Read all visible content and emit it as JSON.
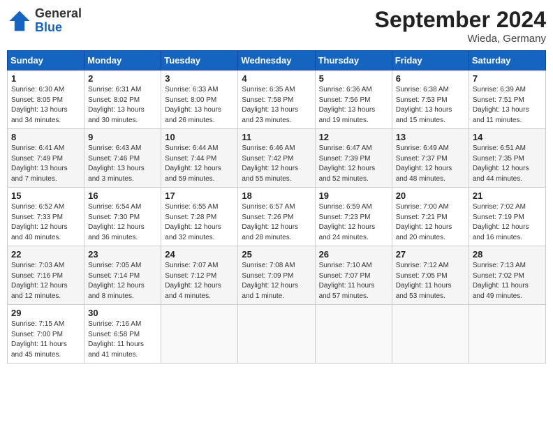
{
  "header": {
    "title": "September 2024",
    "location": "Wieda, Germany",
    "logo_line1": "General",
    "logo_line2": "Blue"
  },
  "weekdays": [
    "Sunday",
    "Monday",
    "Tuesday",
    "Wednesday",
    "Thursday",
    "Friday",
    "Saturday"
  ],
  "weeks": [
    [
      {
        "day": "1",
        "sunrise": "6:30 AM",
        "sunset": "8:05 PM",
        "daylight": "13 hours and 34 minutes."
      },
      {
        "day": "2",
        "sunrise": "6:31 AM",
        "sunset": "8:02 PM",
        "daylight": "13 hours and 30 minutes."
      },
      {
        "day": "3",
        "sunrise": "6:33 AM",
        "sunset": "8:00 PM",
        "daylight": "13 hours and 26 minutes."
      },
      {
        "day": "4",
        "sunrise": "6:35 AM",
        "sunset": "7:58 PM",
        "daylight": "13 hours and 23 minutes."
      },
      {
        "day": "5",
        "sunrise": "6:36 AM",
        "sunset": "7:56 PM",
        "daylight": "13 hours and 19 minutes."
      },
      {
        "day": "6",
        "sunrise": "6:38 AM",
        "sunset": "7:53 PM",
        "daylight": "13 hours and 15 minutes."
      },
      {
        "day": "7",
        "sunrise": "6:39 AM",
        "sunset": "7:51 PM",
        "daylight": "13 hours and 11 minutes."
      }
    ],
    [
      {
        "day": "8",
        "sunrise": "6:41 AM",
        "sunset": "7:49 PM",
        "daylight": "13 hours and 7 minutes."
      },
      {
        "day": "9",
        "sunrise": "6:43 AM",
        "sunset": "7:46 PM",
        "daylight": "13 hours and 3 minutes."
      },
      {
        "day": "10",
        "sunrise": "6:44 AM",
        "sunset": "7:44 PM",
        "daylight": "12 hours and 59 minutes."
      },
      {
        "day": "11",
        "sunrise": "6:46 AM",
        "sunset": "7:42 PM",
        "daylight": "12 hours and 55 minutes."
      },
      {
        "day": "12",
        "sunrise": "6:47 AM",
        "sunset": "7:39 PM",
        "daylight": "12 hours and 52 minutes."
      },
      {
        "day": "13",
        "sunrise": "6:49 AM",
        "sunset": "7:37 PM",
        "daylight": "12 hours and 48 minutes."
      },
      {
        "day": "14",
        "sunrise": "6:51 AM",
        "sunset": "7:35 PM",
        "daylight": "12 hours and 44 minutes."
      }
    ],
    [
      {
        "day": "15",
        "sunrise": "6:52 AM",
        "sunset": "7:33 PM",
        "daylight": "12 hours and 40 minutes."
      },
      {
        "day": "16",
        "sunrise": "6:54 AM",
        "sunset": "7:30 PM",
        "daylight": "12 hours and 36 minutes."
      },
      {
        "day": "17",
        "sunrise": "6:55 AM",
        "sunset": "7:28 PM",
        "daylight": "12 hours and 32 minutes."
      },
      {
        "day": "18",
        "sunrise": "6:57 AM",
        "sunset": "7:26 PM",
        "daylight": "12 hours and 28 minutes."
      },
      {
        "day": "19",
        "sunrise": "6:59 AM",
        "sunset": "7:23 PM",
        "daylight": "12 hours and 24 minutes."
      },
      {
        "day": "20",
        "sunrise": "7:00 AM",
        "sunset": "7:21 PM",
        "daylight": "12 hours and 20 minutes."
      },
      {
        "day": "21",
        "sunrise": "7:02 AM",
        "sunset": "7:19 PM",
        "daylight": "12 hours and 16 minutes."
      }
    ],
    [
      {
        "day": "22",
        "sunrise": "7:03 AM",
        "sunset": "7:16 PM",
        "daylight": "12 hours and 12 minutes."
      },
      {
        "day": "23",
        "sunrise": "7:05 AM",
        "sunset": "7:14 PM",
        "daylight": "12 hours and 8 minutes."
      },
      {
        "day": "24",
        "sunrise": "7:07 AM",
        "sunset": "7:12 PM",
        "daylight": "12 hours and 4 minutes."
      },
      {
        "day": "25",
        "sunrise": "7:08 AM",
        "sunset": "7:09 PM",
        "daylight": "12 hours and 1 minute."
      },
      {
        "day": "26",
        "sunrise": "7:10 AM",
        "sunset": "7:07 PM",
        "daylight": "11 hours and 57 minutes."
      },
      {
        "day": "27",
        "sunrise": "7:12 AM",
        "sunset": "7:05 PM",
        "daylight": "11 hours and 53 minutes."
      },
      {
        "day": "28",
        "sunrise": "7:13 AM",
        "sunset": "7:02 PM",
        "daylight": "11 hours and 49 minutes."
      }
    ],
    [
      {
        "day": "29",
        "sunrise": "7:15 AM",
        "sunset": "7:00 PM",
        "daylight": "11 hours and 45 minutes."
      },
      {
        "day": "30",
        "sunrise": "7:16 AM",
        "sunset": "6:58 PM",
        "daylight": "11 hours and 41 minutes."
      },
      null,
      null,
      null,
      null,
      null
    ]
  ]
}
